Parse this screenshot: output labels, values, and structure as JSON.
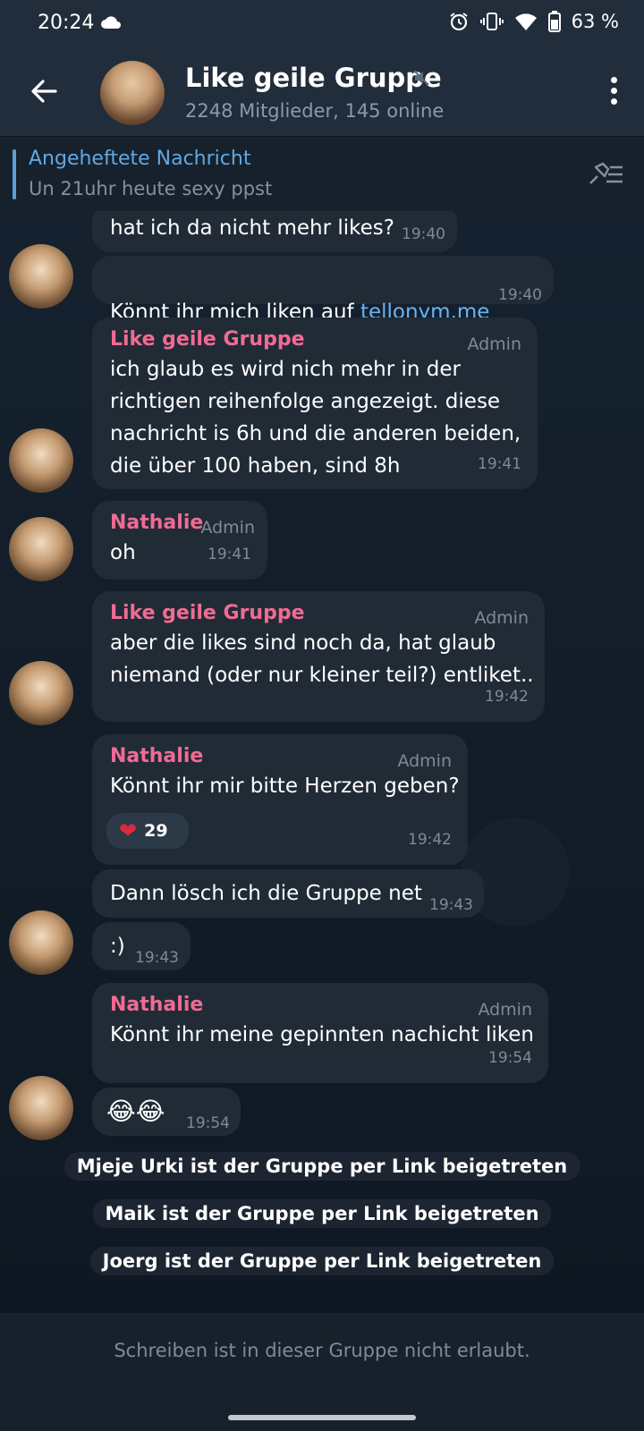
{
  "status_bar": {
    "time": "20:24",
    "battery": "63 %"
  },
  "header": {
    "title": "Like geile Gruppe",
    "subtitle": "2248 Mitglieder, 145 online"
  },
  "pinned": {
    "title": "Angeheftete Nachricht",
    "text": "Un 21uhr heute sexy ppst"
  },
  "messages": [
    {
      "text": "hat ich da nicht mehr likes?",
      "time": "19:40"
    },
    {
      "text_before": "Könnt ihr mich liken auf ",
      "link": "tellonym.me",
      "time": "19:40"
    },
    {
      "sender": "Like geile Gruppe",
      "role": "Admin",
      "text": "ich glaub es wird nich mehr in der\nrichtigen reihenfolge angezeigt. diese\nnachricht is 6h und die anderen beiden,\ndie über 100 haben, sind 8h",
      "time": "19:41"
    },
    {
      "sender": "Nathalie",
      "role": "Admin",
      "text": "oh",
      "time": "19:41"
    },
    {
      "sender": "Like geile Gruppe",
      "role": "Admin",
      "text": "aber die likes sind noch da, hat glaub\nniemand (oder nur kleiner teil?) entliket..",
      "time": "19:42"
    },
    {
      "sender": "Nathalie",
      "role": "Admin",
      "text": "Könnt ihr mir bitte Herzen geben?",
      "reaction_count": "29",
      "time": "19:42"
    },
    {
      "text": "Dann lösch ich die Gruppe net",
      "time": "19:43"
    },
    {
      "text": ":)",
      "time": "19:43"
    },
    {
      "sender": "Nathalie",
      "role": "Admin",
      "text": "Könnt ihr meine gepinnten nachicht liken",
      "time": "19:54"
    },
    {
      "text": "😂😂",
      "time": "19:54"
    }
  ],
  "service_messages": [
    "Mjeje Urki ist der Gruppe per Link beigetreten",
    "Maik ist der Gruppe per Link beigetreten",
    "Joerg ist der Gruppe per Link beigetreten"
  ],
  "footer": {
    "text": "Schreiben ist in dieser Gruppe nicht erlaubt."
  },
  "colors": {
    "accent": "#5ea9e5",
    "sender": "#f06b93",
    "bubble": "#202b36"
  }
}
